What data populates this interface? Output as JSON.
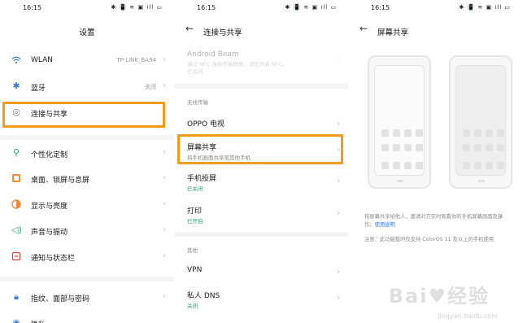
{
  "colors": {
    "highlight": "#f29b1d",
    "link": "#2c7be5",
    "green": "#2aa56a"
  },
  "status": {
    "time": "16:15",
    "icons": "✱ 📳 ≋ ▣ ıll ▭"
  },
  "settings": {
    "title": "设置",
    "items": [
      {
        "label": "WLAN",
        "value": "TP-LINK_BA94",
        "icon": "wifi-icon"
      },
      {
        "label": "蓝牙",
        "value": "关闭",
        "icon": "bluetooth-icon"
      },
      {
        "label": "连接与共享",
        "value": "",
        "icon": "connection-icon"
      },
      {
        "label": "个性化定制",
        "value": "",
        "icon": "personalize-icon"
      },
      {
        "label": "桌面、锁屏与息屏",
        "value": "",
        "icon": "desktop-icon"
      },
      {
        "label": "显示与亮度",
        "value": "",
        "icon": "display-icon"
      },
      {
        "label": "声音与振动",
        "value": "",
        "icon": "sound-icon"
      },
      {
        "label": "通知与状态栏",
        "value": "",
        "icon": "notification-icon"
      },
      {
        "label": "指纹、面部与密码",
        "value": "",
        "icon": "fingerprint-icon"
      },
      {
        "label": "隐私",
        "value": "",
        "icon": "privacy-icon"
      }
    ]
  },
  "connect": {
    "title": "连接与共享",
    "android_beam": {
      "label": "Android Beam",
      "sub1": "通过 NFC 连接传输数据，请先开启 NFC。",
      "sub2": "已关闭"
    },
    "section_wireless": "无线传输",
    "oppo_tv": "OPPO 电视",
    "screen_share": {
      "label": "屏幕共享",
      "sub": "将手机画面共享至其他手机"
    },
    "cast": {
      "label": "手机投屏",
      "sub": "已关闭"
    },
    "print": {
      "label": "打印",
      "sub": "已开启"
    },
    "section_other": "其他",
    "vpn": "VPN",
    "dns": {
      "label": "私人 DNS",
      "sub": "关闭"
    }
  },
  "share": {
    "title": "屏幕共享",
    "desc1": "将屏幕共享给他人，邀请对方实时观看你的手机屏幕画面及操作。",
    "desc_link": "使用说明",
    "note": "注意：此功能暂时仅支持 ColorOS 11 及以上的手机使用"
  },
  "watermark": {
    "logo": "Bai♥经验",
    "url": "jingyan.baidu.com"
  }
}
